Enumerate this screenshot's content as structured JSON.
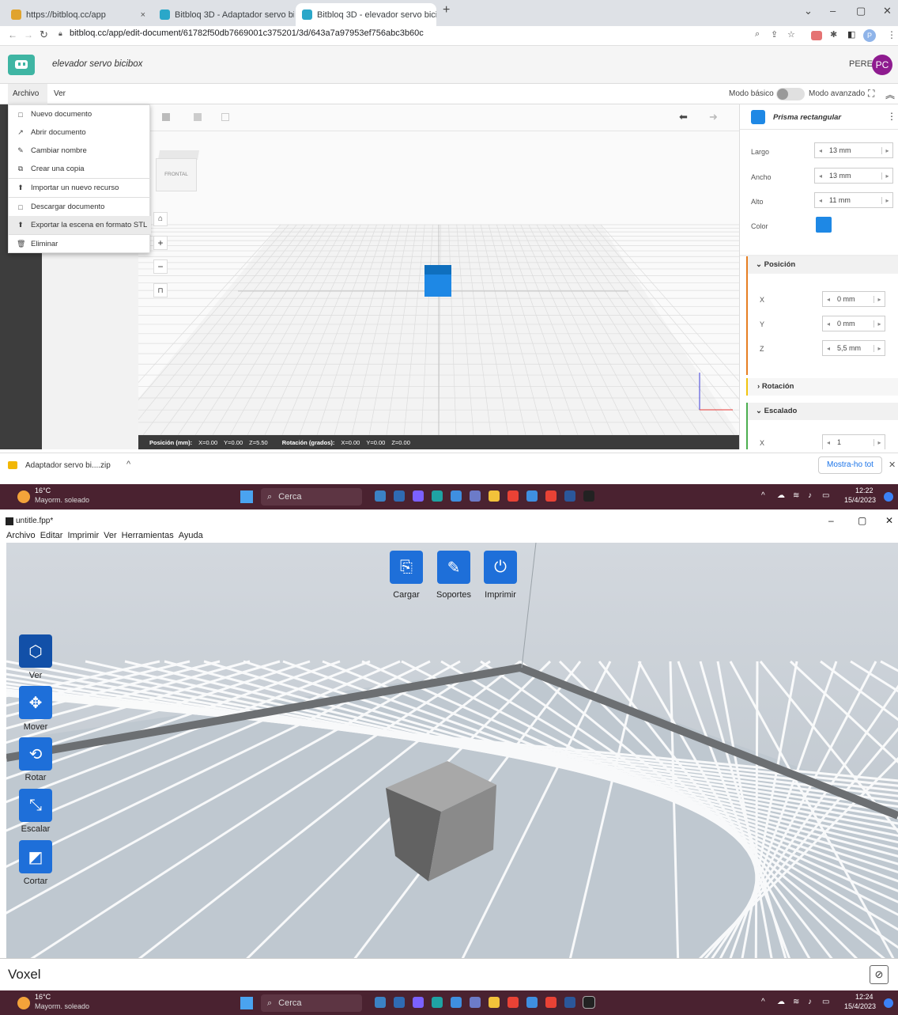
{
  "browser": {
    "tabs": [
      {
        "label": "https://bitbloq.cc/app",
        "close": "×"
      },
      {
        "label": "Bitbloq 3D - Adaptador servo bic",
        "close": "×"
      },
      {
        "label": "Bitbloq 3D - elevador servo bicib",
        "close": "×"
      }
    ],
    "new_tab": "+",
    "url": "bitbloq.cc/app/edit-document/61782f50db7669001c375201/3d/643a7a97953ef756abc3b60c",
    "profile_letter": "P"
  },
  "bitbloq": {
    "doc_title": "elevador servo bicibox",
    "user_name": "PERE",
    "avatar_initials": "PC",
    "menu": {
      "archivo": "Archivo",
      "ver": "Ver"
    },
    "mode_basic": "Modo básico",
    "mode_advanced": "Modo avanzado",
    "file_menu": [
      {
        "label": "Nuevo documento",
        "icon": "□"
      },
      {
        "label": "Abrir documento",
        "icon": "↗"
      },
      {
        "label": "Cambiar nombre",
        "icon": "✎"
      },
      {
        "label": "Crear una copia",
        "icon": "⧉"
      },
      {
        "label": "Importar un nuevo recurso",
        "icon": "⬆"
      },
      {
        "label": "Descargar documento",
        "icon": "□"
      },
      {
        "label": "Exportar la escena en formato STL",
        "icon": "⬆"
      },
      {
        "label": "Eliminar",
        "icon": "🗑"
      }
    ],
    "cube_label": "FRONTAL",
    "status": {
      "pos_label": "Posición (mm):",
      "pos_x": "X=0.00",
      "pos_y": "Y=0.00",
      "pos_z": "Z=5.50",
      "rot_label": "Rotación (grados):",
      "rot_x": "X=0.00",
      "rot_y": "Y=0.00",
      "rot_z": "Z=0.00"
    },
    "panel": {
      "object_name": "Prisma rectangular",
      "largo_label": "Largo",
      "largo": "13 mm",
      "ancho_label": "Ancho",
      "ancho": "13 mm",
      "alto_label": "Alto",
      "alto": "11 mm",
      "color_label": "Color",
      "object_color": "#1e88e5",
      "posicion": "Posición",
      "x_label": "X",
      "x": "0 mm",
      "y_label": "Y",
      "y": "0 mm",
      "z_label": "Z",
      "z": "5,5 mm",
      "rotacion": "Rotación",
      "escalado": "Escalado",
      "sx_label": "X",
      "sx": "1"
    }
  },
  "download": {
    "file": "Adaptador servo bi....zip",
    "show_all": "Mostra-ho tot"
  },
  "taskbar_top": {
    "temp": "16°C",
    "weather": "Mayorm. soleado",
    "search": "Cerca",
    "time": "12:22",
    "date": "15/4/2023"
  },
  "slicer": {
    "title": "untitle.fpp*",
    "menu": [
      "Archivo",
      "Editar",
      "Imprimir",
      "Ver",
      "Herramientas",
      "Ayuda"
    ],
    "top_tools": [
      "Cargar",
      "Soportes",
      "Imprimir"
    ],
    "left_tools": [
      "Ver",
      "Mover",
      "Rotar",
      "Escalar",
      "Cortar"
    ],
    "printer": "Voxel"
  },
  "taskbar_bottom": {
    "temp": "16°C",
    "weather": "Mayorm. soleado",
    "search": "Cerca",
    "time": "12:24",
    "date": "15/4/2023"
  }
}
